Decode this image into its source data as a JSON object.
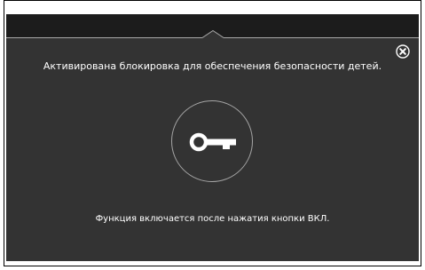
{
  "dialog": {
    "message": "Активирована блокировка для обеспечения безопасности детей.",
    "hint": "Функция включается после нажатия кнопки ВКЛ."
  },
  "icons": {
    "close": "close-circle-icon",
    "key": "key-icon"
  },
  "colors": {
    "panel_background": "#333333",
    "top_bar": "#1c1c1c",
    "text": "#ffffff",
    "circle_outline": "#a6a6a6"
  }
}
